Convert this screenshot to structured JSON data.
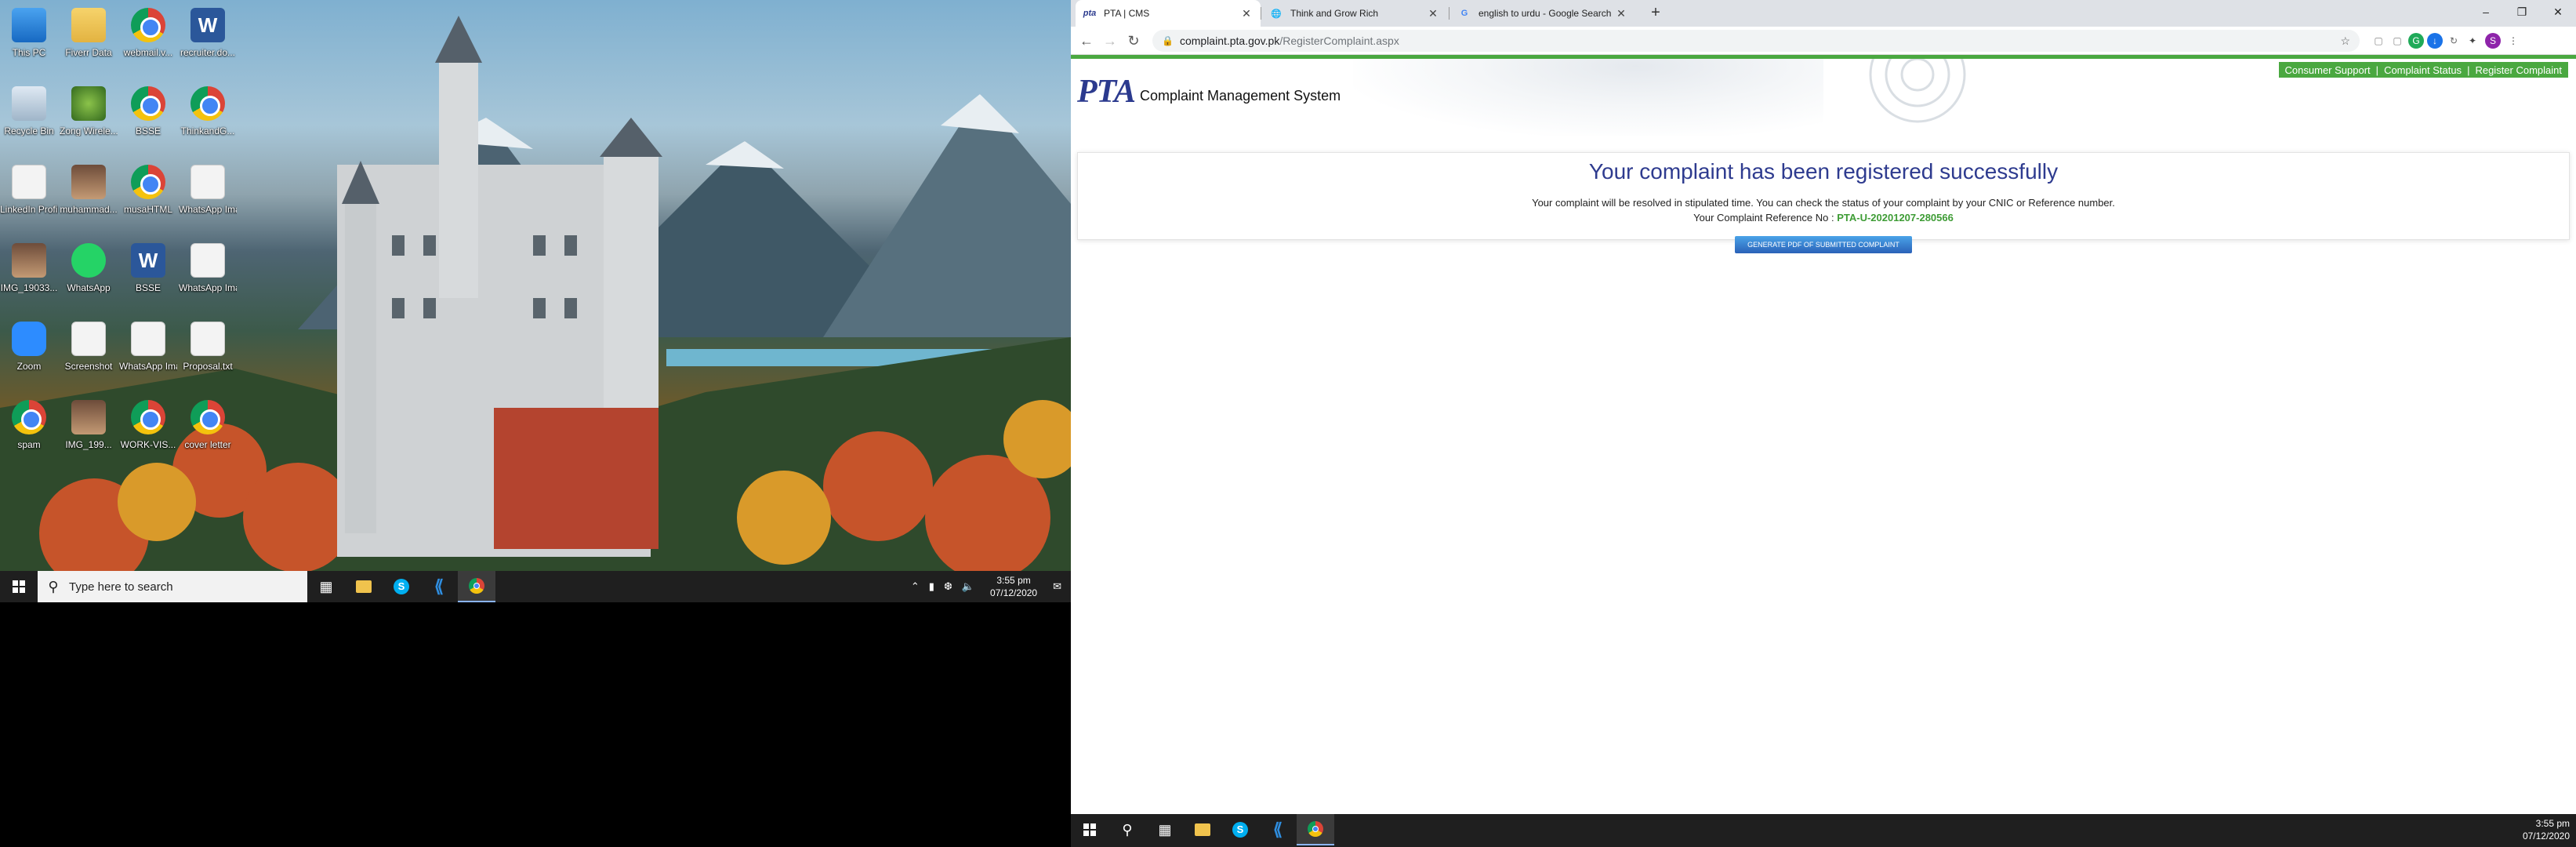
{
  "desktop_left": {
    "icons": [
      {
        "label": "This PC",
        "icon": "computer-icon"
      },
      {
        "label": "Fiverr Data",
        "icon": "folder-icon"
      },
      {
        "label": "webmail.v...",
        "icon": "chrome-icon"
      },
      {
        "label": "recruiter.do...",
        "icon": "word-icon"
      },
      {
        "label": "Recycle Bin",
        "icon": "recycle-bin-icon"
      },
      {
        "label": "Zong Wirele...",
        "icon": "zong-icon"
      },
      {
        "label": "BSSE",
        "icon": "chrome-icon"
      },
      {
        "label": "ThinkandG...",
        "icon": "chrome-icon"
      },
      {
        "label": "LinkedIn Profile",
        "icon": "file-icon"
      },
      {
        "label": "muhammad...",
        "icon": "photo-icon"
      },
      {
        "label": "musaHTML",
        "icon": "chrome-icon"
      },
      {
        "label": "WhatsApp Image 2020...",
        "icon": "file-icon"
      },
      {
        "label": "IMG_19033...",
        "icon": "photo-icon"
      },
      {
        "label": "WhatsApp",
        "icon": "whatsapp-icon"
      },
      {
        "label": "BSSE",
        "icon": "word-icon"
      },
      {
        "label": "WhatsApp Image 2019...",
        "icon": "file-icon"
      },
      {
        "label": "Zoom",
        "icon": "zoom-icon"
      },
      {
        "label": "Screenshot",
        "icon": "file-icon"
      },
      {
        "label": "WhatsApp Image 2019...",
        "icon": "file-icon"
      },
      {
        "label": "Proposal.txt",
        "icon": "file-icon"
      },
      {
        "label": "spam",
        "icon": "chrome-icon"
      },
      {
        "label": "IMG_199...",
        "icon": "photo-icon"
      },
      {
        "label": "WORK-VIS...",
        "icon": "chrome-icon"
      },
      {
        "label": "cover letter",
        "icon": "chrome-icon"
      }
    ],
    "taskbar": {
      "search_placeholder": "Type here to search",
      "time": "3:55 pm",
      "date": "07/12/2020"
    }
  },
  "browser": {
    "tabs": [
      {
        "title": "PTA | CMS",
        "favicon": "pta-favicon"
      },
      {
        "title": "Think and Grow Rich",
        "favicon": "globe-icon"
      },
      {
        "title": "english to urdu - Google Search",
        "favicon": "google-icon"
      }
    ],
    "url_host": "complaint.pta.gov.pk",
    "url_path": "/RegisterComplaint.aspx",
    "profile_letter": "S"
  },
  "page": {
    "logo_text": "PTA",
    "system_name": "Complaint Management System",
    "nav": [
      "Consumer Support",
      "Complaint Status",
      "Register Complaint"
    ],
    "nav_separator": "|",
    "heading": "Your complaint has been registered successfully",
    "message": "Your complaint will be resolved in stipulated time. You can check the status of your complaint by your CNIC or Reference number.",
    "ref_label": "Your Complaint Reference No :",
    "ref_number": "PTA-U-20201207-280566",
    "pdf_button": "GENERATE PDF OF SUBMITTED COMPLAINT",
    "colors": {
      "accent_green": "#4aa840",
      "heading_blue": "#2e3b8f",
      "ref_green": "#3e9c35"
    }
  },
  "taskbar_right": {
    "time": "3:55 pm",
    "date": "07/12/2020"
  }
}
